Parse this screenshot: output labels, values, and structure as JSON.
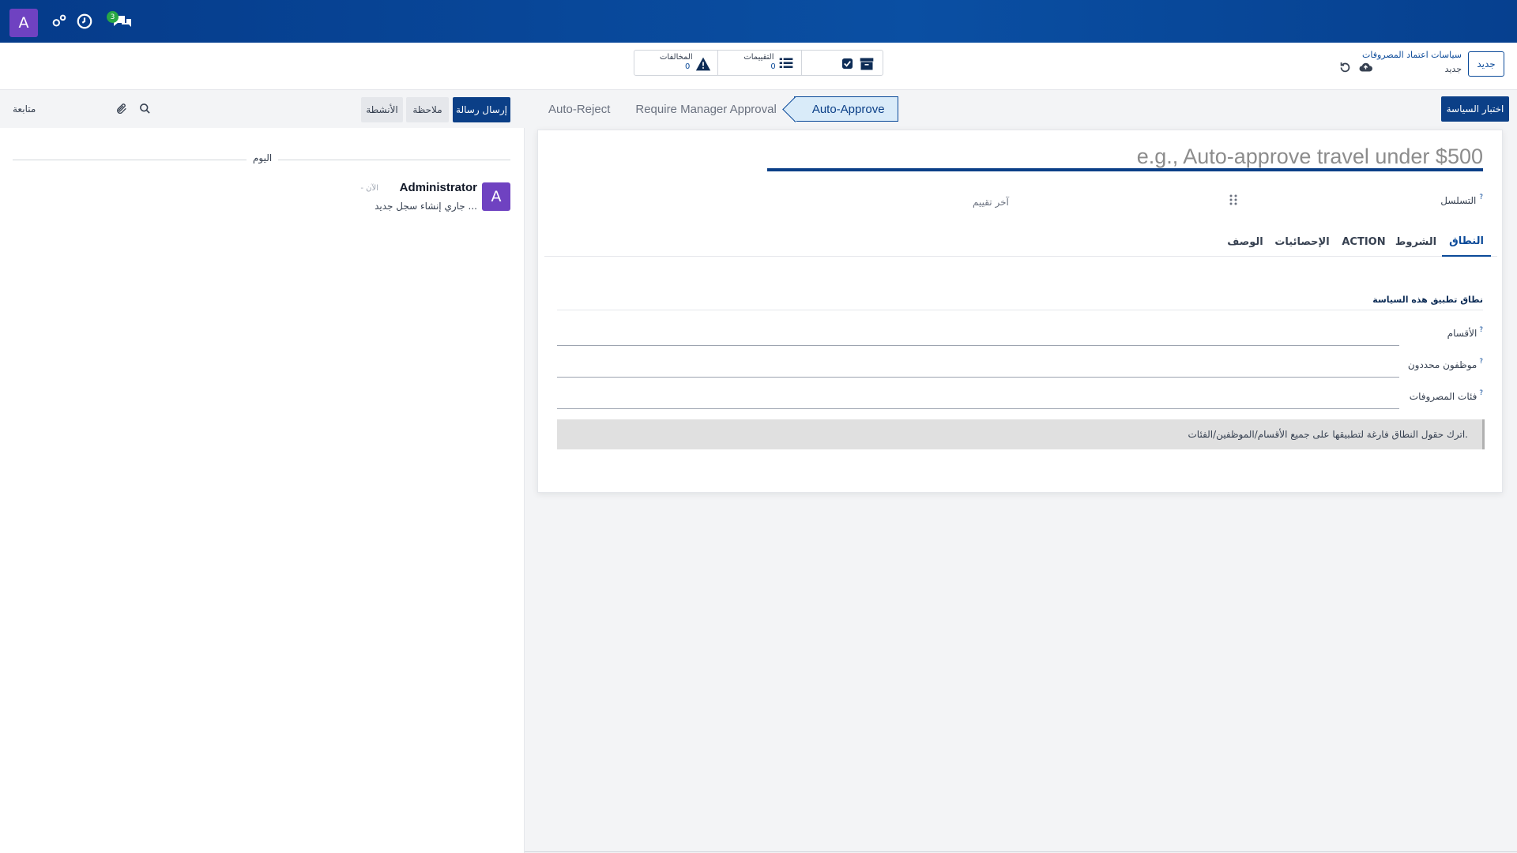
{
  "navbar": {
    "avatar_letter": "A",
    "chat_badge": "3",
    "colors": {
      "bar": "#0a4fa3",
      "avatar": "#6f42c1",
      "badge": "#28a745"
    }
  },
  "control": {
    "new_button": "جديد",
    "breadcrumb_parent": "سياسات اعتماد المصروفات",
    "breadcrumb_current": "جديد",
    "smart_buttons": [
      {
        "label": "المخالفات",
        "count": "0",
        "icon": "warning-icon"
      },
      {
        "label": "التقييمات",
        "count": "0",
        "icon": "list-icon"
      },
      {
        "label": "",
        "count": "",
        "icon": "archive-icon"
      }
    ]
  },
  "form": {
    "test_policy_button": "اختبار السياسة",
    "status": [
      "Auto-Approve",
      "Require Manager Approval",
      "Auto-Reject"
    ],
    "active_status": "Auto-Approve",
    "name_placeholder": "e.g., Auto-approve travel under $500",
    "sequence_label": "التسلسل",
    "last_evaluated_label": "آخر تقييم",
    "tabs": [
      "النطاق",
      "الشروط",
      "ACTION",
      "الإحصائيات",
      "الوصف"
    ],
    "scope": {
      "title": "نطاق تطبيق هذه السياسة",
      "fields": [
        "الأقسام",
        "موظفون محددون",
        "فئات المصروفات"
      ],
      "hint": "اترك حقول النطاق فارغة لتطبيقها على جميع الأقسام/الموظفين/الفئات."
    }
  },
  "chatter": {
    "send_message": "إرسال رسالة",
    "log_note": "ملاحظة",
    "activities": "الأنشطة",
    "follow": "متابعة",
    "today": "اليوم",
    "message": {
      "avatar_letter": "A",
      "author": "Administrator",
      "time": "- الآن",
      "body": "جاري إنشاء سجل جديد ..."
    }
  }
}
